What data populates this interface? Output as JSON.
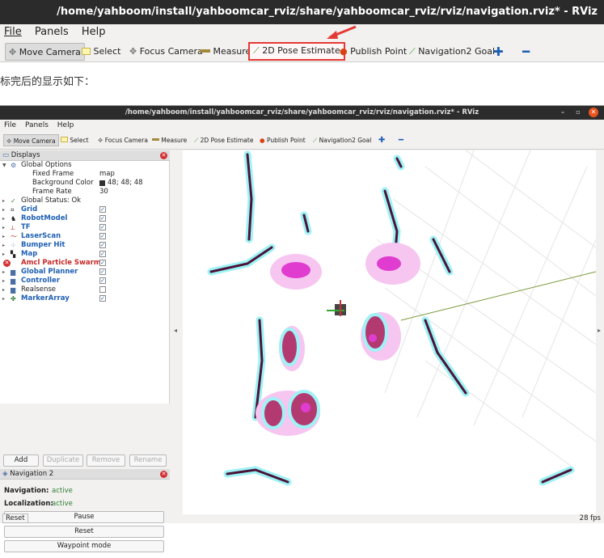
{
  "top_window": {
    "title": "/home/yahboom/install/yahboomcar_rviz/share/yahboomcar_rviz/rviz/navigation.rviz* - RViz",
    "menu": [
      "File",
      "Panels",
      "Help"
    ],
    "toolbar": [
      "Move Camera",
      "Select",
      "Focus Camera",
      "Measure",
      "2D Pose Estimate",
      "Publish Point",
      "Navigation2 Goal"
    ]
  },
  "caption": "标完后的显示如下：",
  "rviz": {
    "title": "/home/yahboom/install/yahboomcar_rviz/share/yahboomcar_rviz/rviz/navigation.rviz* - RViz",
    "menu": [
      "File",
      "Panels",
      "Help"
    ],
    "toolbar": [
      "Move Camera",
      "Select",
      "Focus Camera",
      "Measure",
      "2D Pose Estimate",
      "Publish Point",
      "Navigation2 Goal"
    ],
    "displays": {
      "title": "Displays",
      "global_options": "Global Options",
      "fixed_frame_label": "Fixed Frame",
      "fixed_frame_value": "map",
      "bg_color_label": "Background Color",
      "bg_color_value": "48; 48; 48",
      "frame_rate_label": "Frame Rate",
      "frame_rate_value": "30",
      "global_status": "Global Status: Ok",
      "items": [
        "Grid",
        "RobotModel",
        "TF",
        "LaserScan",
        "Bumper Hit",
        "Map",
        "Amcl Particle Swarm",
        "Global Planner",
        "Controller",
        "Realsense",
        "MarkerArray"
      ]
    },
    "buttons": [
      "Add",
      "Duplicate",
      "Remove",
      "Rename"
    ],
    "nav2": {
      "title": "Navigation 2",
      "navigation_label": "Navigation:",
      "navigation_value": "active",
      "localization_label": "Localization:",
      "localization_value": "active",
      "pause": "Pause",
      "reset": "Reset",
      "waypoint": "Waypoint mode"
    },
    "status": {
      "reset": "Reset",
      "fps": "28 fps"
    }
  },
  "colors": {
    "highlight": "#e53935",
    "active": "#2e7d32",
    "dark": "#2c2c2c"
  }
}
